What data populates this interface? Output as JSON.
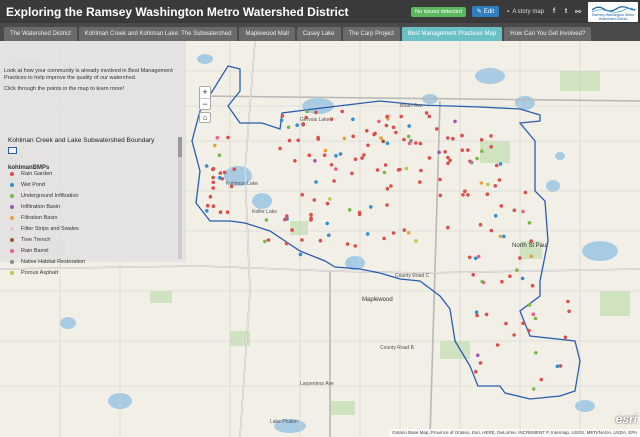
{
  "header": {
    "title": "Exploring the Ramsey Washington Metro Watershed District",
    "status_badge": "No issues detected",
    "edit_label": "Edit",
    "story_label": "A story map",
    "social_icons": [
      "facebook-icon",
      "twitter-icon",
      "link-icon"
    ],
    "logo_text": "Ramsey-Washington Metro Watershed District"
  },
  "tabs": [
    {
      "label": "The Watershed District",
      "active": false
    },
    {
      "label": "Kohlman Creek and Kohlman Lake: The Subwatershed",
      "active": false
    },
    {
      "label": "Maplewood Mall",
      "active": false
    },
    {
      "label": "Casey Lake",
      "active": false
    },
    {
      "label": "The Carp Project",
      "active": false
    },
    {
      "label": "Best Management Practices Map",
      "active": true
    },
    {
      "label": "How Can You Get Involved?",
      "active": false
    }
  ],
  "panel": {
    "intro_1": "Look at how your community is already involved in Best Management Practices to help improve the quality of our watershed.",
    "intro_2": "Click through the points in the map to learn more!",
    "boundary_title": "Kohlman Creek and Lake Subwatershed Boundary",
    "bmp_title": "kohlmanBMPs",
    "legend": [
      {
        "label": "Rain Garden",
        "color": "#d94f4f"
      },
      {
        "label": "Wet Pond",
        "color": "#2f8fd0"
      },
      {
        "label": "Underground Infiltration",
        "color": "#7bb84a"
      },
      {
        "label": "Infiltration Basin",
        "color": "#9b59b6"
      },
      {
        "label": "Filtration Basin",
        "color": "#e9a23b"
      },
      {
        "label": "Filter Strips and Swales",
        "color": "#f0c0d0"
      },
      {
        "label": "Tree Trench",
        "color": "#a0522d"
      },
      {
        "label": "Rain Barrel",
        "color": "#e8608a"
      },
      {
        "label": "Native Habitat Restoration",
        "color": "#8a8a8a"
      },
      {
        "label": "Porous Asphalt",
        "color": "#b8c84a"
      }
    ]
  },
  "map": {
    "zoom_in": "+",
    "zoom_out": "−",
    "home": "⌂",
    "labels": [
      "Kohlman Lake",
      "Gervais Lake",
      "Keller Lake",
      "Maplewood",
      "North St Paul",
      "Lake Phalen",
      "County Road B",
      "County Road C",
      "Beam Ave",
      "Larpenteur Ave"
    ],
    "attribution": "Ontario Base Map, Province of Ontario, Esri, HERE, DeLorme, INCREMENT P, Intermap, USGS, METI/NASA, USDA, EPA",
    "esri_label": "esri"
  }
}
